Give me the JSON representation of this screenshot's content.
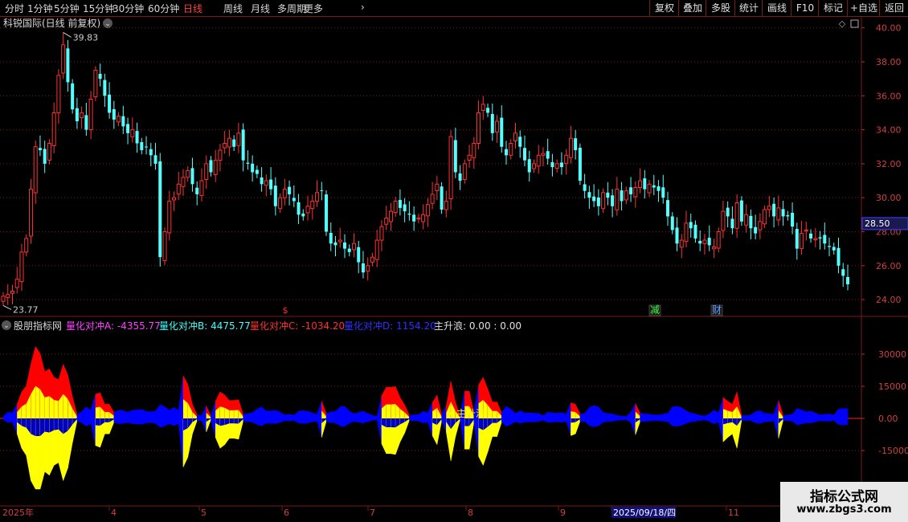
{
  "toolbar": {
    "periods": [
      "分时",
      "1分钟",
      "5分钟",
      "15分钟",
      "30分钟",
      "60分钟",
      "日线",
      "周线",
      "月线",
      "多周期",
      "更多"
    ],
    "active_period": "日线",
    "right_buttons": [
      "复权",
      "叠加",
      "多股",
      "统计",
      "画线",
      "F10",
      "标记",
      "+自选",
      "返回"
    ]
  },
  "main_chart": {
    "title": "科锐国际(日线 前复权)",
    "high_label": "39.83",
    "low_label": "23.77",
    "price_badge": "28.50",
    "y_ticks": [
      "40.00",
      "38.00",
      "36.00",
      "34.00",
      "32.00",
      "30.00",
      "28.00",
      "26.00",
      "24.00"
    ],
    "markers": [
      {
        "text": "$",
        "color": "#ff3030"
      },
      {
        "text": "减",
        "color": "#40ff40"
      },
      {
        "text": "财",
        "color": "#60a0ff"
      }
    ]
  },
  "indicator": {
    "name": "股朋指标网",
    "legend": [
      {
        "text": "量化对冲A: -4355.77",
        "color": "#ff40ff"
      },
      {
        "text": "量化对冲B: 4475.77",
        "color": "#40ffff"
      },
      {
        "text": "量化对冲C: -1034.20",
        "color": "#ff3030"
      },
      {
        "text": "量化对冲D: 1154.20",
        "color": "#3030ff"
      },
      {
        "text": "主升浪: 0.00 : 0.00",
        "color": "#e0e0e0"
      }
    ],
    "annotation": "主升浪",
    "y_ticks": [
      "30000",
      "15000",
      "0.00",
      "-15000"
    ]
  },
  "x_axis": {
    "labels": [
      "2025年",
      "4",
      "5",
      "6",
      "7",
      "8",
      "9",
      "2025/09/18/四",
      "11"
    ]
  },
  "watermark": {
    "line1": "指标公式网",
    "line2": "www.zbgs3.com"
  },
  "colors": {
    "up": "#ff3232",
    "down": "#54ffff",
    "grid": "#7a1a1a",
    "yellow": "#ffff00",
    "blue": "#0000ff",
    "red": "#ff0000"
  },
  "chart_data": {
    "type": "candlestick",
    "title": "科锐国际(日线 前复权)",
    "ylim": [
      23.2,
      40.6
    ],
    "close": [
      24.2,
      24.3,
      24.5,
      25.2,
      26.8,
      27.6,
      30.5,
      33.0,
      32.8,
      32.0,
      33.2,
      35.0,
      37.2,
      39.0,
      36.8,
      35.2,
      34.5,
      35.0,
      34.0,
      35.8,
      37.5,
      37.0,
      36.0,
      35.0,
      34.6,
      34.8,
      34.2,
      33.8,
      34.0,
      33.2,
      32.8,
      33.0,
      32.5,
      32.0,
      26.5,
      28.0,
      29.8,
      30.0,
      30.8,
      31.2,
      31.6,
      30.8,
      30.2,
      31.0,
      32.0,
      31.5,
      32.2,
      32.8,
      33.2,
      33.5,
      33.0,
      33.8,
      32.2,
      32.0,
      31.5,
      31.4,
      30.8,
      31.0,
      30.5,
      29.5,
      30.0,
      30.5,
      30.2,
      29.8,
      29.0,
      28.9,
      29.5,
      29.8,
      30.3,
      30.4,
      28.0,
      27.3,
      27.2,
      27.5,
      27.0,
      26.8,
      27.3,
      26.2,
      25.6,
      26.0,
      26.5,
      27.5,
      28.3,
      28.8,
      29.2,
      29.8,
      29.4,
      29.2,
      29.0,
      28.6,
      28.8,
      29.0,
      29.6,
      30.2,
      30.8,
      29.3,
      29.8,
      33.6,
      31.5,
      31.0,
      32.0,
      32.5,
      33.2,
      35.0,
      35.5,
      35.0,
      33.8,
      34.5,
      33.0,
      32.5,
      33.2,
      33.8,
      33.0,
      32.2,
      31.5,
      32.0,
      32.5,
      32.6,
      32.3,
      31.8,
      32.0,
      31.8,
      32.5,
      33.5,
      32.8,
      31.0,
      30.4,
      30.0,
      29.8,
      29.5,
      30.3,
      30.0,
      29.5,
      30.5,
      29.8,
      30.4,
      30.2,
      30.6,
      31.0,
      30.5,
      30.8,
      30.6,
      30.4,
      30.0,
      28.9,
      28.1,
      27.3,
      27.5,
      28.5,
      28.2,
      27.6,
      27.3,
      27.5,
      27.2,
      27.1,
      28.0,
      29.2,
      28.9,
      28.2,
      29.7,
      28.6,
      29.0,
      28.2,
      27.9,
      28.6,
      29.3,
      29.5,
      28.9,
      29.4,
      28.9,
      28.9,
      28.3,
      27.0,
      27.9,
      28.1,
      27.6,
      27.6,
      27.6,
      27.3,
      27.1,
      26.9,
      26.0,
      25.4,
      24.9
    ]
  }
}
